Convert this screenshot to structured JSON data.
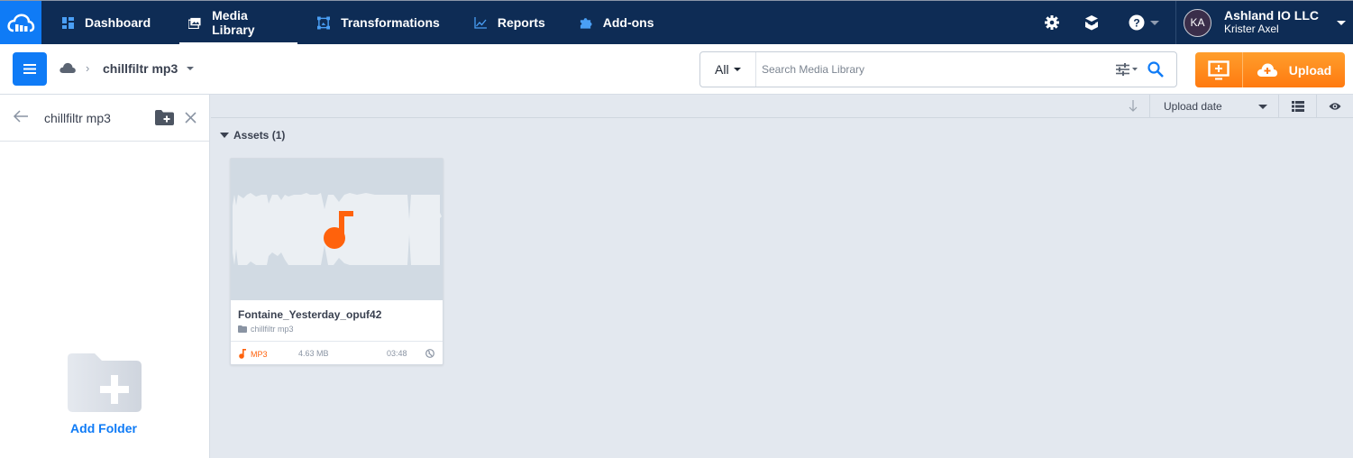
{
  "nav": {
    "items": [
      {
        "label": "Dashboard",
        "icon": "dashboard-icon",
        "active": false
      },
      {
        "label": "Media Library",
        "icon": "media-library-icon",
        "active": true
      },
      {
        "label": "Transformations",
        "icon": "transformations-icon",
        "active": false
      },
      {
        "label": "Reports",
        "icon": "reports-icon",
        "active": false
      },
      {
        "label": "Add-ons",
        "icon": "puzzle-icon",
        "active": false
      }
    ],
    "account": {
      "initials": "KA",
      "org": "Ashland IO LLC",
      "user": "Krister Axel"
    }
  },
  "subbar": {
    "breadcrumb_folder": "chillfiltr mp3",
    "breadcrumb_separator": "›",
    "search": {
      "type": "All",
      "placeholder": "Search Media Library",
      "value": ""
    },
    "upload_label": "Upload"
  },
  "sidebar": {
    "title": "chillfiltr mp3",
    "add_folder_label": "Add Folder"
  },
  "toolbar": {
    "sort_by": "Upload date"
  },
  "assets": {
    "heading": "Assets (1)",
    "items": [
      {
        "name": "Fontaine_Yesterday_opuf42",
        "folder": "chillfiltr mp3",
        "format": "MP3",
        "size": "4.63 MB",
        "duration": "03:48",
        "access": "public"
      }
    ]
  },
  "colors": {
    "nav_bg": "#0e2c55",
    "brand_blue": "#0f7bf6",
    "accent_orange": "#ff7a10",
    "audio_orange": "#ff620c"
  }
}
